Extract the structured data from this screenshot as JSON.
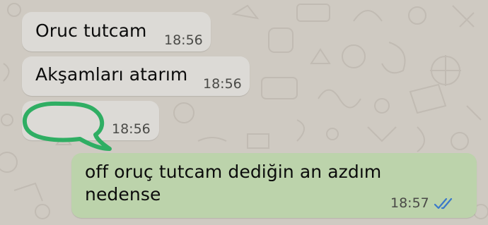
{
  "chat": {
    "messages": [
      {
        "direction": "incoming",
        "text": "Oruc tutcam",
        "time": "18:56"
      },
      {
        "direction": "incoming",
        "text": "Akşamları atarım",
        "time": "18:56"
      },
      {
        "direction": "incoming",
        "text": "",
        "time": "18:56",
        "content_note_icon": "green-speech-bubble-scribble"
      },
      {
        "direction": "outgoing",
        "text": "off oruç tutcam dediğin an azdım nedense",
        "time": "18:57",
        "status_icon": "double-check-read-icon"
      }
    ]
  },
  "colors": {
    "wallpaper": "#cfcac2",
    "incoming_bubble": "#dcdad6",
    "outgoing_bubble": "#bcd3ab",
    "scribble_green": "#2fae63",
    "read_ticks": "#3a78c9"
  }
}
